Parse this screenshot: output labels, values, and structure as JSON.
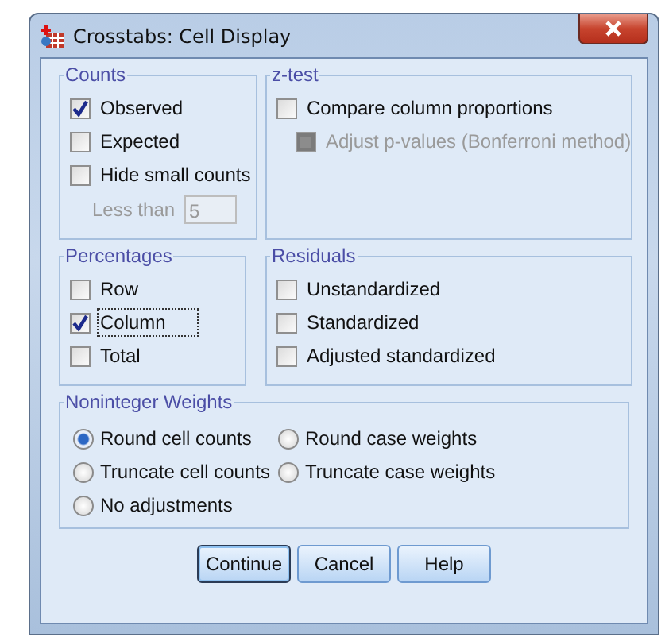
{
  "window": {
    "title": "Crosstabs: Cell Display"
  },
  "groups": [
    {
      "title": "Counts",
      "items": [
        {
          "kind": "checkbox",
          "label": "Observed",
          "checked": true,
          "disabled": false,
          "focused": false
        },
        {
          "kind": "checkbox",
          "label": "Expected",
          "checked": false,
          "disabled": false,
          "focused": false
        },
        {
          "kind": "checkbox",
          "label": "Hide small counts",
          "checked": false,
          "disabled": false,
          "focused": false
        },
        {
          "kind": "field",
          "label": "Less than",
          "value": "5",
          "disabled": true
        }
      ]
    },
    {
      "title": "z-test",
      "items": [
        {
          "kind": "checkbox",
          "label": "Compare column proportions",
          "checked": false,
          "disabled": false,
          "focused": false,
          "children": [
            {
              "kind": "checkbox",
              "label": "Adjust p-values (Bonferroni method)",
              "checked": false,
              "disabled": true,
              "focused": false
            }
          ]
        }
      ]
    },
    {
      "title": "Percentages",
      "items": [
        {
          "kind": "checkbox",
          "label": "Row",
          "checked": false,
          "disabled": false,
          "focused": false
        },
        {
          "kind": "checkbox",
          "label": "Column",
          "checked": true,
          "disabled": false,
          "focused": true
        },
        {
          "kind": "checkbox",
          "label": "Total",
          "checked": false,
          "disabled": false,
          "focused": false
        }
      ]
    },
    {
      "title": "Residuals",
      "items": [
        {
          "kind": "checkbox",
          "label": "Unstandardized",
          "checked": false,
          "disabled": false,
          "focused": false
        },
        {
          "kind": "checkbox",
          "label": "Standardized",
          "checked": false,
          "disabled": false,
          "focused": false
        },
        {
          "kind": "checkbox",
          "label": "Adjusted standardized",
          "checked": false,
          "disabled": false,
          "focused": false
        }
      ]
    }
  ],
  "weights": {
    "title": "Noninteger Weights",
    "options": [
      {
        "label": "Round cell counts",
        "selected": true
      },
      {
        "label": "Round case weights",
        "selected": false
      },
      {
        "label": "Truncate cell counts",
        "selected": false
      },
      {
        "label": "Truncate case weights",
        "selected": false
      },
      {
        "label": "No adjustments",
        "selected": false
      }
    ]
  },
  "buttons": [
    {
      "label": "Continue",
      "default": true
    },
    {
      "label": "Cancel",
      "default": false
    },
    {
      "label": "Help",
      "default": false
    }
  ]
}
